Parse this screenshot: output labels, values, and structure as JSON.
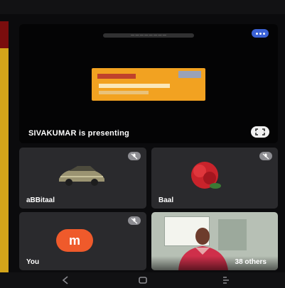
{
  "presenter": {
    "status_text": "SIVAKUMAR is presenting",
    "slide_caption": "— — — — — — — —"
  },
  "participants": [
    {
      "name": "aBBitaal",
      "avatar": "car-image"
    },
    {
      "name": "Baal",
      "avatar": "flower-image"
    },
    {
      "name": "You",
      "avatar": "initials",
      "initials": "m"
    },
    {
      "name": "38 others",
      "avatar": "video"
    }
  ],
  "colors": {
    "stage_bg": "#040405",
    "tile_bg": "#2a2a2d",
    "avatar_orange": "#ef5a2b",
    "badge_blue": "#3b62d6"
  },
  "nav": {
    "back": "back-icon",
    "home": "home-icon",
    "recents": "recents-icon"
  }
}
